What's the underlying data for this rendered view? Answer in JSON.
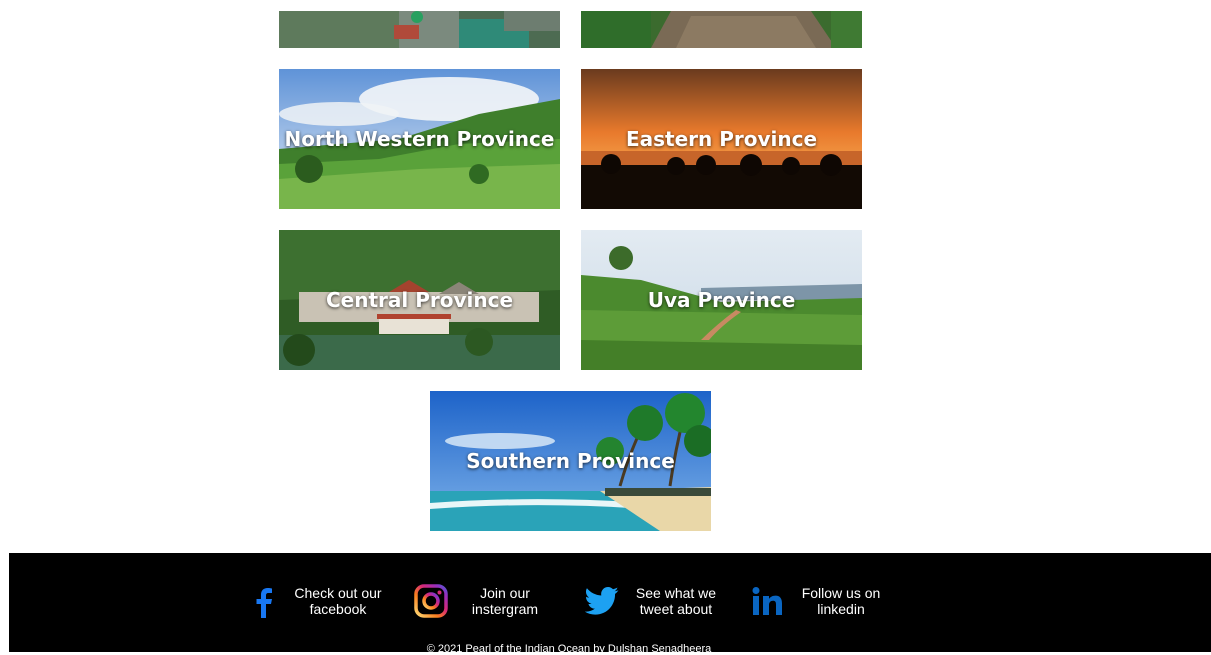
{
  "cards": {
    "north_western": "North Western Province",
    "eastern": "Eastern Province",
    "central": "Central Province",
    "uva": "Uva Province",
    "southern": "Southern Province"
  },
  "footer": {
    "facebook": "Check out our facebook",
    "instagram": "Join our instergram",
    "twitter": "See what we tweet about",
    "linkedin": "Follow us on linkedin",
    "copyright": "© 2021 Pearl of the Indian Ocean by Dulshan Senadheera"
  },
  "icons": [
    "facebook-icon",
    "instagram-icon",
    "twitter-icon",
    "linkedin-icon"
  ],
  "colors": {
    "footer_bg": "#000000",
    "facebook": "#1877f2",
    "twitter": "#1da1f2",
    "linkedin": "#0a66c2"
  }
}
